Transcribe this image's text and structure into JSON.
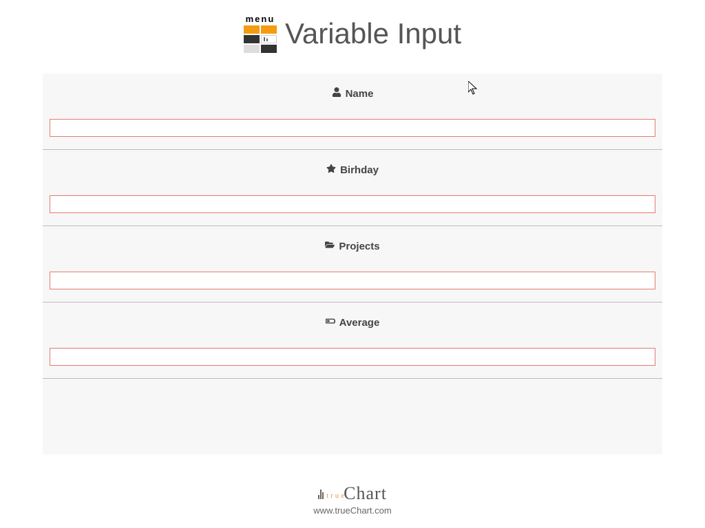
{
  "header": {
    "menu_label": "menu",
    "title": "Variable Input"
  },
  "form": {
    "sections": [
      {
        "icon": "user-icon",
        "label": "Name",
        "value": ""
      },
      {
        "icon": "star-icon",
        "label": "Birhday",
        "value": ""
      },
      {
        "icon": "folder-icon",
        "label": "Projects",
        "value": ""
      },
      {
        "icon": "battery-icon",
        "label": "Average",
        "value": ""
      }
    ]
  },
  "footer": {
    "brand_true": "true",
    "brand_chart": "Chart",
    "url": "www.trueChart.com"
  }
}
